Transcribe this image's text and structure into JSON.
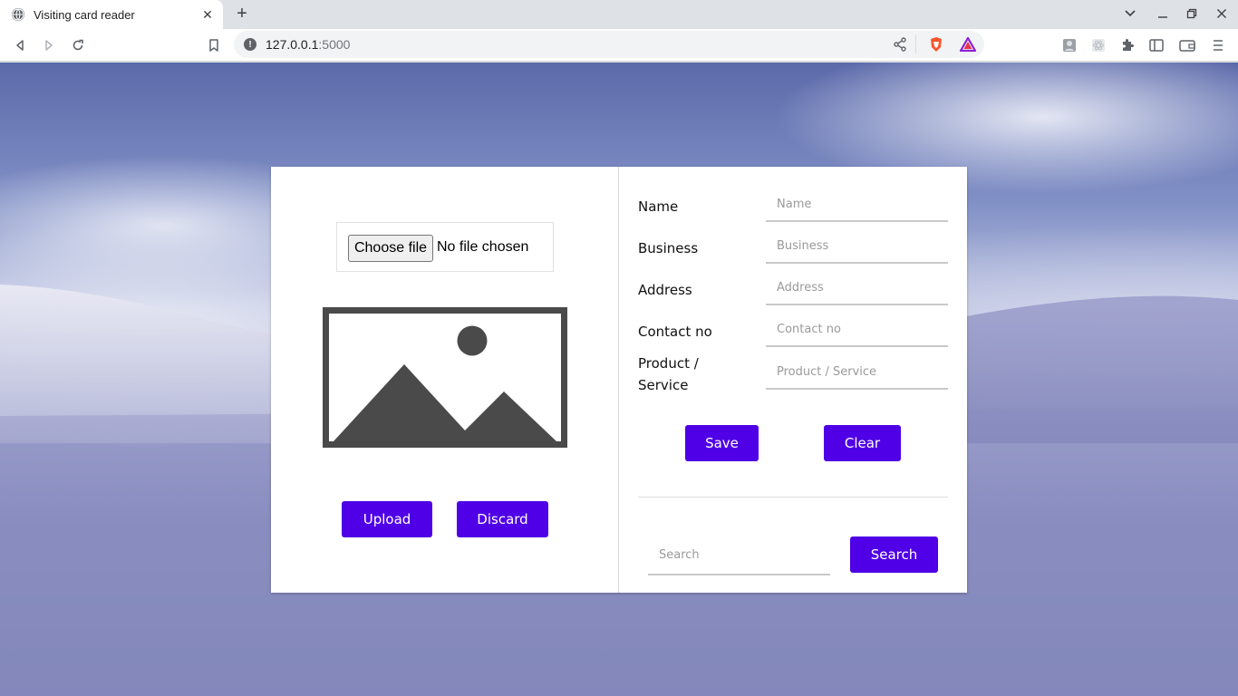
{
  "browser": {
    "tab_title": "Visiting card reader",
    "tab_close": "✕",
    "new_tab": "+",
    "url_host": "127.0.0.1",
    "url_port": ":5000"
  },
  "uploader": {
    "choose_file_label": "Choose file",
    "file_status": "No file chosen",
    "upload_label": "Upload",
    "discard_label": "Discard"
  },
  "form": {
    "fields": [
      {
        "label": "Name",
        "placeholder": "Name",
        "value": ""
      },
      {
        "label": "Business",
        "placeholder": "Business",
        "value": ""
      },
      {
        "label": "Address",
        "placeholder": "Address",
        "value": ""
      },
      {
        "label": "Contact no",
        "placeholder": "Contact no",
        "value": ""
      },
      {
        "label": "Product / Service",
        "placeholder": "Product / Service",
        "value": ""
      }
    ],
    "save_label": "Save",
    "clear_label": "Clear"
  },
  "search": {
    "placeholder": "Search",
    "value": "",
    "button_label": "Search"
  },
  "colors": {
    "primary_button": "#4f00e6",
    "placeholder_image": "#4a4a4a"
  }
}
